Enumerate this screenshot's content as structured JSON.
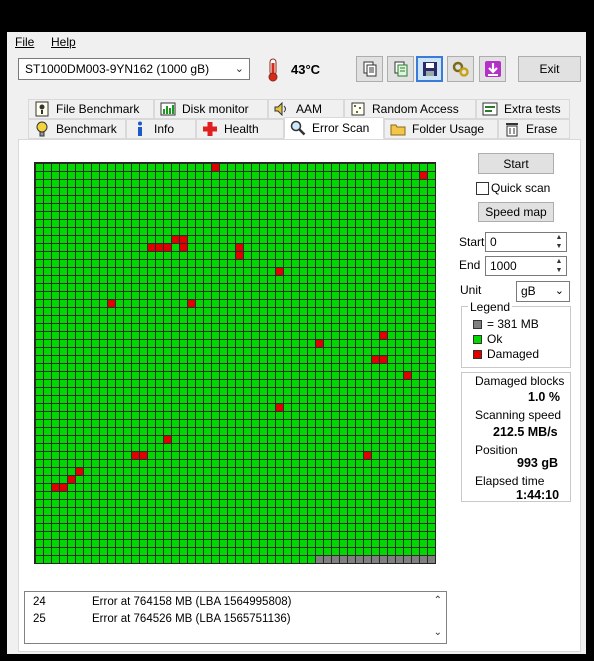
{
  "menu": {
    "file": "File",
    "help": "Help"
  },
  "toolbar": {
    "drive": "ST1000DM003-9YN162 (1000 gB)",
    "temperature": "43°C",
    "exit_label": "Exit",
    "icons": [
      "copy-icon",
      "copy-all-icon",
      "save-icon",
      "options-icon",
      "download-icon"
    ]
  },
  "tabs": {
    "row1": [
      {
        "label": "File Benchmark",
        "icon": "file-benchmark-icon"
      },
      {
        "label": "Disk monitor",
        "icon": "disk-monitor-icon"
      },
      {
        "label": "AAM",
        "icon": "speaker-icon"
      },
      {
        "label": "Random Access",
        "icon": "random-access-icon"
      },
      {
        "label": "Extra tests",
        "icon": "extra-tests-icon"
      }
    ],
    "row2": [
      {
        "label": "Benchmark",
        "icon": "bulb-icon"
      },
      {
        "label": "Info",
        "icon": "info-icon"
      },
      {
        "label": "Health",
        "icon": "health-icon"
      },
      {
        "label": "Error Scan",
        "icon": "magnifier-icon",
        "active": true
      },
      {
        "label": "Folder Usage",
        "icon": "folder-icon"
      },
      {
        "label": "Erase",
        "icon": "trash-icon"
      }
    ]
  },
  "scan": {
    "start_button": "Start",
    "quick_scan_label": "Quick scan",
    "quick_scan_checked": false,
    "speed_map_button": "Speed map",
    "start_label": "Start",
    "start_value": "0",
    "end_label": "End",
    "end_value": "1000",
    "unit_label": "Unit",
    "unit_value": "gB"
  },
  "legend": {
    "title": "Legend",
    "block_size": "= 381 MB",
    "ok": "Ok",
    "damaged": "Damaged"
  },
  "stats": {
    "damaged_label": "Damaged blocks",
    "damaged_value": "1.0 %",
    "speed_label": "Scanning speed",
    "speed_value": "212.5 MB/s",
    "position_label": "Position",
    "position_value": "993 gB",
    "elapsed_label": "Elapsed time",
    "elapsed_value": "1:44:10"
  },
  "map": {
    "columns": 50,
    "rows": 50,
    "damaged_cells": [
      [
        48,
        1
      ],
      [
        14,
        10
      ],
      [
        15,
        10
      ],
      [
        16,
        10
      ],
      [
        22,
        0
      ],
      [
        14,
        10
      ],
      [
        25,
        10
      ],
      [
        18,
        10
      ],
      [
        18,
        9
      ],
      [
        17,
        9
      ],
      [
        25,
        11
      ],
      [
        30,
        13
      ],
      [
        9,
        17
      ],
      [
        19,
        17
      ],
      [
        43,
        21
      ],
      [
        35,
        22
      ],
      [
        42,
        24
      ],
      [
        43,
        24
      ],
      [
        46,
        26
      ],
      [
        30,
        30
      ],
      [
        16,
        34
      ],
      [
        12,
        36
      ],
      [
        13,
        36
      ],
      [
        41,
        36
      ],
      [
        5,
        38
      ],
      [
        4,
        39
      ],
      [
        2,
        40
      ],
      [
        3,
        40
      ]
    ],
    "unscanned_cells_row49_from_col": 35
  },
  "log": [
    {
      "num": "24",
      "text": "Error at 764158 MB (LBA 1564995808)"
    },
    {
      "num": "25",
      "text": "Error at 764526 MB (LBA 1565751136)"
    }
  ],
  "colors": {
    "ok": "#00d800",
    "damaged": "#e00000",
    "unscanned": "#808080"
  }
}
